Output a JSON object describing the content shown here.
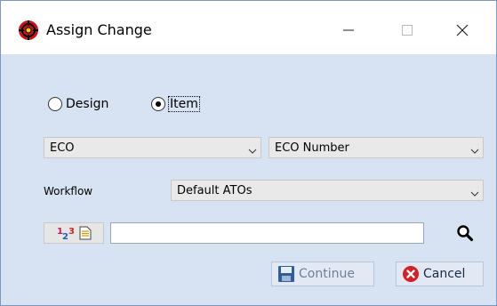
{
  "window": {
    "title": "Assign Change",
    "icon": "target-icon"
  },
  "mode": {
    "options": [
      {
        "label": "Design",
        "checked": false
      },
      {
        "label": "Item",
        "checked": true
      }
    ]
  },
  "change_type": {
    "selected": "ECO"
  },
  "number_field": {
    "selected": "ECO Number"
  },
  "workflow": {
    "label": "Workflow",
    "selected": "Default ATOs"
  },
  "search": {
    "value": "",
    "icons": [
      "numbering-icon",
      "document-icon",
      "magnifier-icon"
    ]
  },
  "actions": {
    "continue_label": "Continue",
    "cancel_label": "Cancel"
  },
  "colors": {
    "client_bg": "#d7e2f3",
    "cancel_red": "#d81f26",
    "save_blue": "#2f5e9e"
  }
}
